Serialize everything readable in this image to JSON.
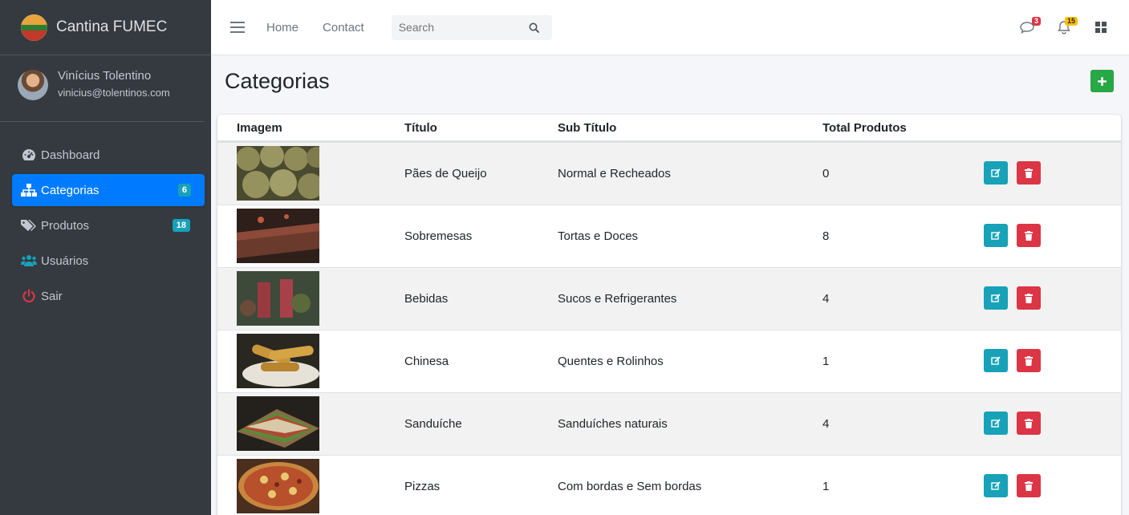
{
  "brand": {
    "name": "Cantina FUMEC",
    "logo_text": "CANTINA FUMEC"
  },
  "user": {
    "name": "Vinícius Tolentino",
    "email": "vinicius@tolentinos.com"
  },
  "sidebar": {
    "items": [
      {
        "label": "Dashboard",
        "icon": "tachometer-icon"
      },
      {
        "label": "Categorias",
        "icon": "sitemap-icon",
        "badge": "6",
        "active": true
      },
      {
        "label": "Produtos",
        "icon": "tags-icon",
        "badge": "18"
      },
      {
        "label": "Usuários",
        "icon": "users-icon"
      },
      {
        "label": "Sair",
        "icon": "power-icon"
      }
    ]
  },
  "topbar": {
    "links": [
      "Home",
      "Contact"
    ],
    "search_placeholder": "Search",
    "messages_count": "3",
    "notifications_count": "15"
  },
  "page": {
    "title": "Categorias"
  },
  "table": {
    "headers": [
      "Imagem",
      "Título",
      "Sub Título",
      "Total Produtos"
    ],
    "rows": [
      {
        "title": "Pães de Queijo",
        "subtitle": "Normal e Recheados",
        "total": "0",
        "image": "paes-de-queijo"
      },
      {
        "title": "Sobremesas",
        "subtitle": "Tortas e Doces",
        "total": "8",
        "image": "sobremesas"
      },
      {
        "title": "Bebidas",
        "subtitle": "Sucos e Refrigerantes",
        "total": "4",
        "image": "bebidas"
      },
      {
        "title": "Chinesa",
        "subtitle": "Quentes e Rolinhos",
        "total": "1",
        "image": "chinesa"
      },
      {
        "title": "Sanduíche",
        "subtitle": "Sanduíches naturais",
        "total": "4",
        "image": "sanduiche"
      },
      {
        "title": "Pizzas",
        "subtitle": "Com bordas e Sem bordas",
        "total": "1",
        "image": "pizzas"
      }
    ]
  },
  "colors": {
    "sidebar_bg": "#343a40",
    "active": "#007bff",
    "badge": "#17a2b8",
    "add": "#28a745",
    "edit": "#17a2b8",
    "delete": "#dc3545"
  }
}
